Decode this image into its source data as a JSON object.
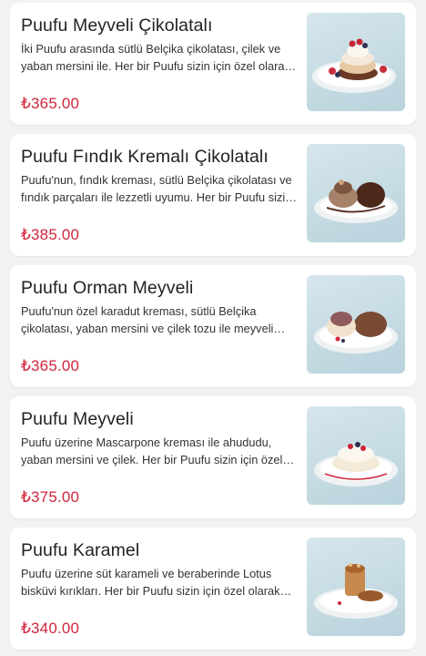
{
  "products": [
    {
      "title": "Puufu Meyveli Çikolatalı",
      "description": "İki Puufu arasında sütlü Belçika çikolatası, çilek ve yaban mersini ile. Her bir Puufu sizin için özel olarak hazırlanır.",
      "price": "₺365.00",
      "image_icon": "pancake-chocolate-berries-image"
    },
    {
      "title": "Puufu Fındık Kremalı Çikolatalı",
      "description": "Puufu'nun, fındık kreması, sütlü Belçika çikolatası ve fındık parçaları ile lezzetli uyumu. Her bir Puufu sizin için özel olarak hazırlanır.",
      "price": "₺385.00",
      "image_icon": "pancake-hazelnut-chocolate-image"
    },
    {
      "title": "Puufu Orman Meyveli",
      "description": "Puufu'nun özel karadut kreması, sütlü Belçika çikolatası, yaban mersini ve çilek tozu ile meyveli lezzeti.",
      "price": "₺365.00",
      "image_icon": "pancake-forest-fruit-image"
    },
    {
      "title": "Puufu Meyveli",
      "description": "Puufu üzerine Mascarpone kreması ile ahududu, yaban mersini ve çilek. Her bir Puufu sizin için özel olarak hazırlanır.",
      "price": "₺375.00",
      "image_icon": "pancake-mascarpone-fruit-image"
    },
    {
      "title": "Puufu Karamel",
      "description": "Puufu üzerine süt karameli ve beraberinde Lotus bisküvi kırıkları. Her bir Puufu sizin için özel olarak hazırlanır.",
      "price": "₺340.00",
      "image_icon": "pancake-caramel-lotus-image"
    }
  ],
  "colors": {
    "price": "#d0263c",
    "background": "#f2f2f2",
    "card": "#ffffff"
  }
}
